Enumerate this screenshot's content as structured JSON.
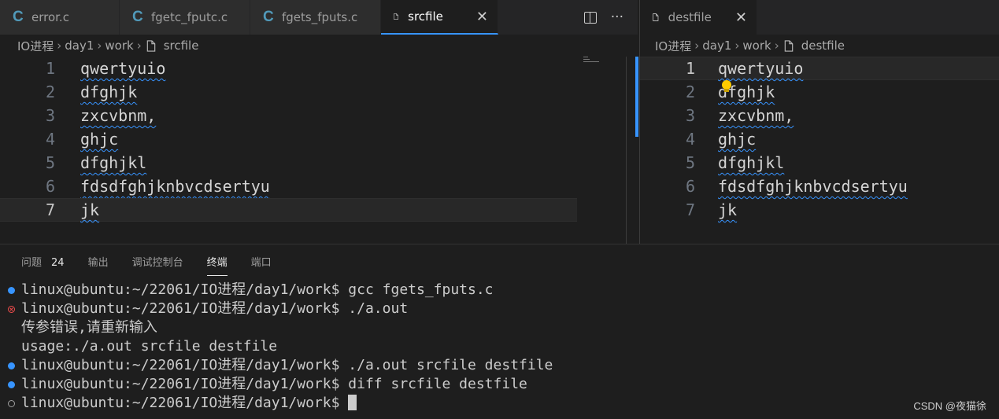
{
  "tabs_left": [
    {
      "label": "error.c",
      "icon": "c-icon"
    },
    {
      "label": "fgetc_fputc.c",
      "icon": "c-icon"
    },
    {
      "label": "fgets_fputs.c",
      "icon": "c-icon"
    },
    {
      "label": "srcfile",
      "icon": "file-icon",
      "active": true
    }
  ],
  "tabs_right": [
    {
      "label": "destfile",
      "icon": "file-icon"
    }
  ],
  "glyphs": {
    "c": "C",
    "close": "✕",
    "more": "···",
    "chevron": "›"
  },
  "breadcrumb_left": {
    "folder1": "IO进程",
    "folder2": "day1",
    "folder3": "work",
    "file": "srcfile"
  },
  "breadcrumb_right": {
    "folder1": "IO进程",
    "folder2": "day1",
    "folder3": "work",
    "file": "destfile"
  },
  "editor_left": {
    "current_line": 7,
    "lines": [
      {
        "num": "1",
        "text": "qwertyuio"
      },
      {
        "num": "2",
        "text": "dfghjk"
      },
      {
        "num": "3",
        "text": "zxcvbnm,"
      },
      {
        "num": "4",
        "text": "ghjc"
      },
      {
        "num": "5",
        "text": "dfghjkl"
      },
      {
        "num": "6",
        "text": "fdsdfghjknbvcdsertyu"
      },
      {
        "num": "7",
        "text": "jk"
      }
    ]
  },
  "editor_right": {
    "current_line": 1,
    "lines": [
      {
        "num": "1",
        "text": "qwertyuio"
      },
      {
        "num": "2",
        "text": "dfghjk"
      },
      {
        "num": "3",
        "text": "zxcvbnm,"
      },
      {
        "num": "4",
        "text": "ghjc"
      },
      {
        "num": "5",
        "text": "dfghjkl"
      },
      {
        "num": "6",
        "text": "fdsdfghjknbvcdsertyu"
      },
      {
        "num": "7",
        "text": "jk"
      }
    ]
  },
  "panel": {
    "tabs": [
      {
        "label": "问题",
        "badge": "24"
      },
      {
        "label": "输出"
      },
      {
        "label": "调试控制台"
      },
      {
        "label": "终端",
        "active": true
      },
      {
        "label": "端口"
      }
    ]
  },
  "terminal": {
    "lines": [
      {
        "status": "ok",
        "text": "linux@ubuntu:~/22061/IO进程/day1/work$ gcc fgets_fputs.c"
      },
      {
        "status": "err",
        "text": "linux@ubuntu:~/22061/IO进程/day1/work$ ./a.out"
      },
      {
        "status": "none",
        "text": "传参错误,请重新输入"
      },
      {
        "status": "none",
        "text": "usage:./a.out srcfile destfile"
      },
      {
        "status": "ok",
        "text": "linux@ubuntu:~/22061/IO进程/day1/work$ ./a.out srcfile destfile"
      },
      {
        "status": "ok",
        "text": "linux@ubuntu:~/22061/IO进程/day1/work$ diff srcfile destfile"
      },
      {
        "status": "idle",
        "text": "linux@ubuntu:~/22061/IO进程/day1/work$ "
      }
    ]
  },
  "watermark": "CSDN @夜猫徐",
  "colors": {
    "accent": "#3794ff",
    "c_icon": "#519aba",
    "error": "#f14c4c",
    "bulb": "#ffcc00"
  }
}
